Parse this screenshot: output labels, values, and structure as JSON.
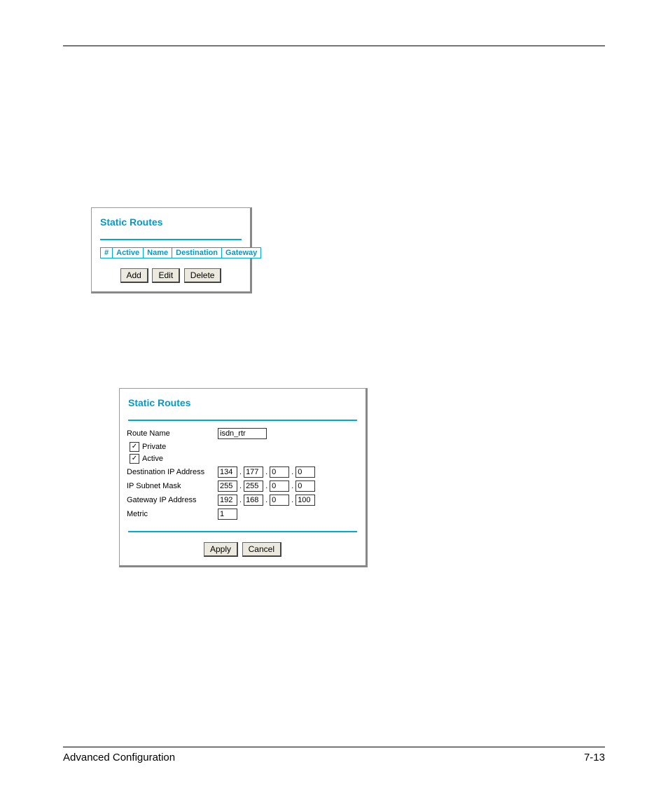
{
  "panel1": {
    "title": "Static Routes",
    "columns": [
      "#",
      "Active",
      "Name",
      "Destination",
      "Gateway"
    ],
    "buttons": {
      "add": "Add",
      "edit": "Edit",
      "delete": "Delete"
    }
  },
  "panel2": {
    "title": "Static Routes",
    "route_name_label": "Route Name",
    "route_name_value": "isdn_rtr",
    "private_label": "Private",
    "private_checked": true,
    "active_label": "Active",
    "active_checked": true,
    "dest_label": "Destination IP Address",
    "dest": [
      "134",
      "177",
      "0",
      "0"
    ],
    "mask_label": "IP Subnet Mask",
    "mask": [
      "255",
      "255",
      "0",
      "0"
    ],
    "gateway_label": "Gateway IP Address",
    "gateway": [
      "192",
      "168",
      "0",
      "100"
    ],
    "metric_label": "Metric",
    "metric_value": "1",
    "buttons": {
      "apply": "Apply",
      "cancel": "Cancel"
    }
  },
  "footer": {
    "left": "Advanced Configuration",
    "right": "7-13"
  }
}
